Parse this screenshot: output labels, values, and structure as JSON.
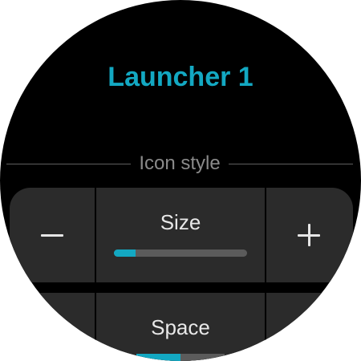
{
  "header": {
    "title": "Launcher 1"
  },
  "section": {
    "label": "Icon style"
  },
  "size_control": {
    "decrease_symbol": "−",
    "increase_symbol": "+",
    "label": "Size",
    "level_fraction": 0.16
  },
  "space_control": {
    "label": "Space",
    "level_fraction": 0.5
  },
  "colors": {
    "accent": "#13a8c2",
    "background": "#000000",
    "panel": "#2b2b2b",
    "track": "#5b5b5b"
  },
  "icons": [
    "minus-icon",
    "plus-icon"
  ]
}
